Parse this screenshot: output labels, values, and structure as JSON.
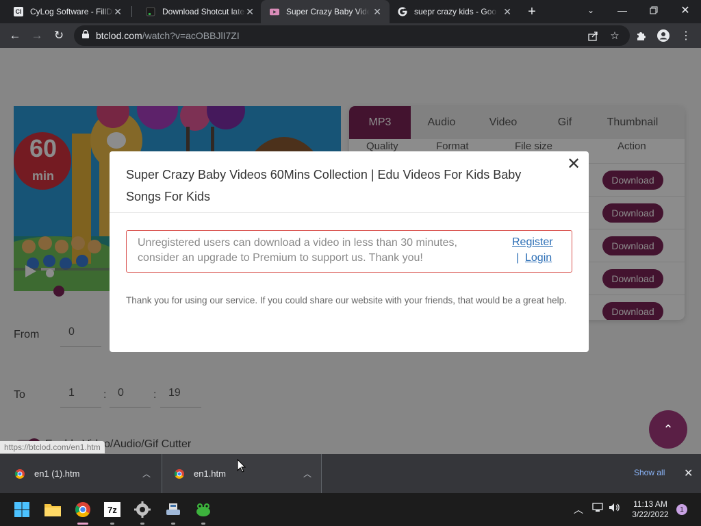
{
  "browser": {
    "tabs": [
      {
        "title": "CyLog Software - FillDi",
        "icon": "cylog-favicon"
      },
      {
        "title": "Download Shotcut late",
        "icon": "shotcut-favicon"
      },
      {
        "title": "Super Crazy Baby Vide",
        "icon": "btclod-favicon"
      },
      {
        "title": "suepr crazy kids - Goo",
        "icon": "google-favicon"
      }
    ],
    "active_tab": 2,
    "url_host": "btclod.com",
    "url_path": "/watch?v=acOBBJlI7ZI"
  },
  "page": {
    "thumbnail_badge_number": "60",
    "thumbnail_badge_unit": "min",
    "format_tabs": [
      "MP3",
      "Audio",
      "Video",
      "Gif",
      "Thumbnail"
    ],
    "table_headers": [
      "Quality",
      "Format",
      "File size",
      "Action"
    ],
    "download_label": "Download",
    "from_label": "From",
    "from_value": "0",
    "to_label": "To",
    "to_values": [
      "1",
      "0",
      "19"
    ],
    "cutter_label": "Enable Video/Audio/Gif Cutter",
    "status_url": "https://btclod.com/en1.htm"
  },
  "modal": {
    "title": "Super Crazy Baby Videos 60Mins Collection | Edu Videos For Kids Baby Songs For Kids",
    "alert_message": "Unregistered users can download a video in less than 30 minutes, consider an upgrade to Premium to support us. Thank you!",
    "register_link": "Register",
    "separator": "|",
    "login_link": "Login",
    "thanks_text": "Thank you for using our service. If you could share our website with your friends, that would be a great help."
  },
  "downloads": [
    {
      "filename": "en1 (1).htm"
    },
    {
      "filename": "en1.htm"
    }
  ],
  "shelf": {
    "show_all": "Show all"
  },
  "taskbar": {
    "time": "11:13 AM",
    "date": "3/22/2022",
    "notification_count": "1",
    "sevenzip_label": "7z"
  },
  "colors": {
    "accent": "#7b2456",
    "fab": "#5a1f45",
    "link": "#2a6db5",
    "alert_border": "#d9534f"
  }
}
